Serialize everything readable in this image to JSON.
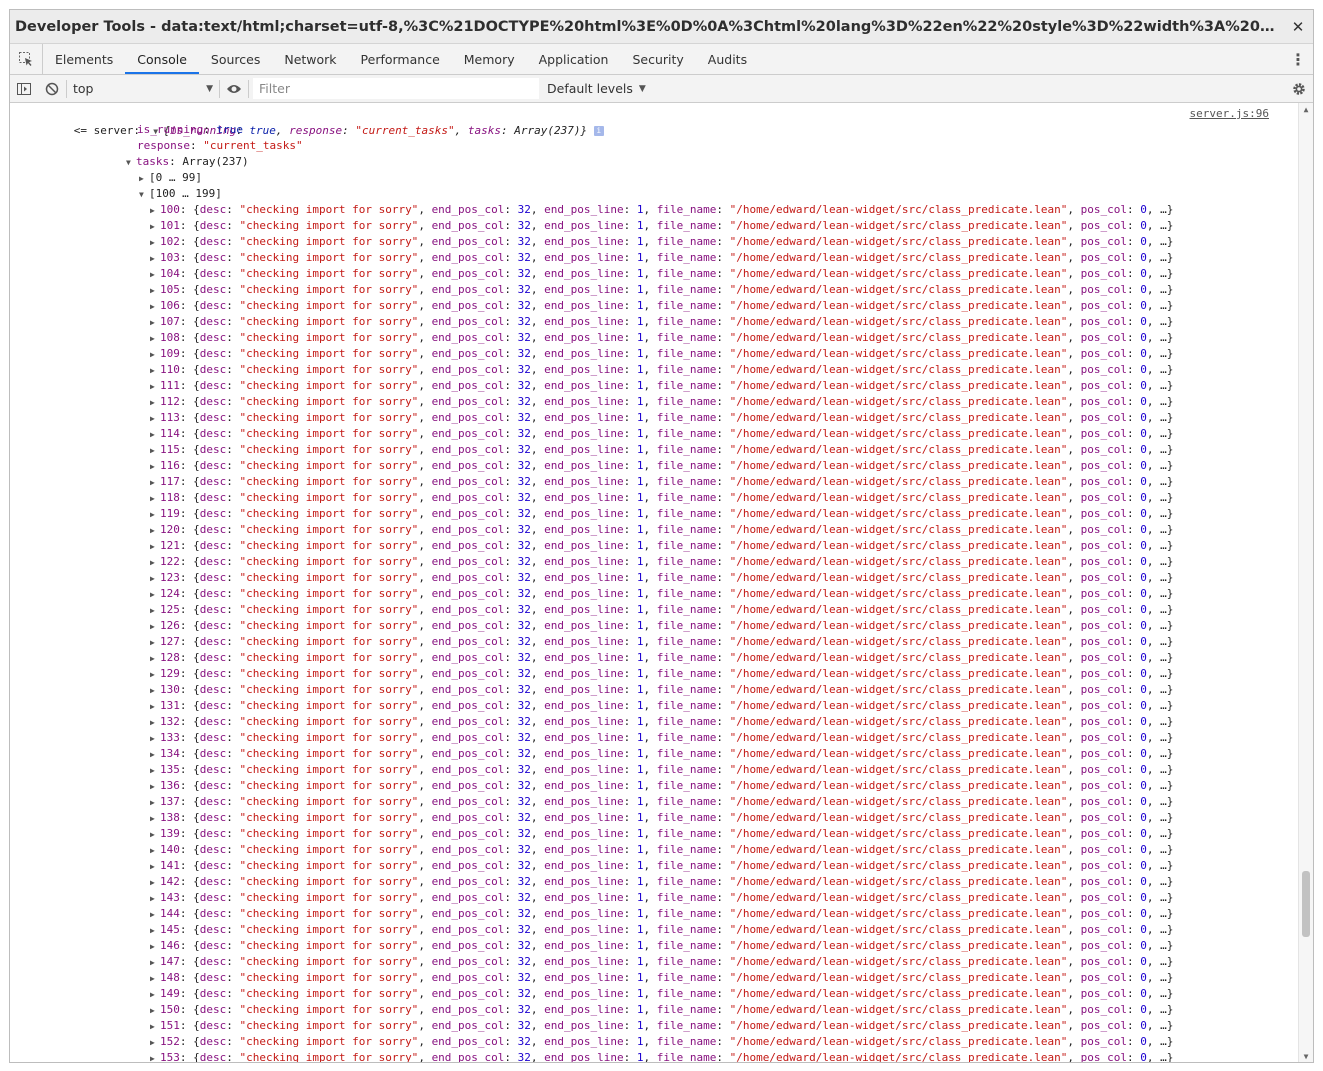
{
  "window": {
    "title": "Developer Tools - data:text/html;charset=utf-8,%3C%21DOCTYPE%20html%3E%0D%0A%3Chtml%20lang%3D%22en%22%20style%3D%22width%3A%20100%25%3B%20heigh…",
    "close": "✕"
  },
  "tabs": [
    "Elements",
    "Console",
    "Sources",
    "Network",
    "Performance",
    "Memory",
    "Application",
    "Security",
    "Audits"
  ],
  "active_tab": "Console",
  "toolbar": {
    "context": "top",
    "filter_placeholder": "Filter",
    "levels_label": "Default levels"
  },
  "console": {
    "source_link": "server.js:96",
    "prefix": "<= server:",
    "summary": {
      "is_running": "true",
      "response": "\"current_tasks\"",
      "tasks": "Array(237)"
    },
    "is_running_value": "true",
    "response_value": "\"current_tasks\"",
    "tasks_label": "Array(237)",
    "group_collapsed": "[0 … 99]",
    "group_expanded": "[100 … 199]",
    "row_template": {
      "desc": "\"checking import for sorry\"",
      "end_pos_col": "32",
      "end_pos_line": "1",
      "file_name": "\"/home/edward/lean-widget/src/class_predicate.lean\"",
      "pos_col": "0"
    },
    "row_indices": [
      "100",
      "101",
      "102",
      "103",
      "104",
      "105",
      "106",
      "107",
      "108",
      "109",
      "110",
      "111",
      "112",
      "113",
      "114",
      "115",
      "116",
      "117",
      "118",
      "119",
      "120",
      "121",
      "122",
      "123",
      "124",
      "125",
      "126",
      "127",
      "128",
      "129",
      "130",
      "131",
      "132",
      "133",
      "134",
      "135",
      "136",
      "137",
      "138",
      "139",
      "140",
      "141",
      "142",
      "143",
      "144",
      "145",
      "146",
      "147",
      "148",
      "149",
      "150",
      "151",
      "152",
      "153"
    ]
  }
}
